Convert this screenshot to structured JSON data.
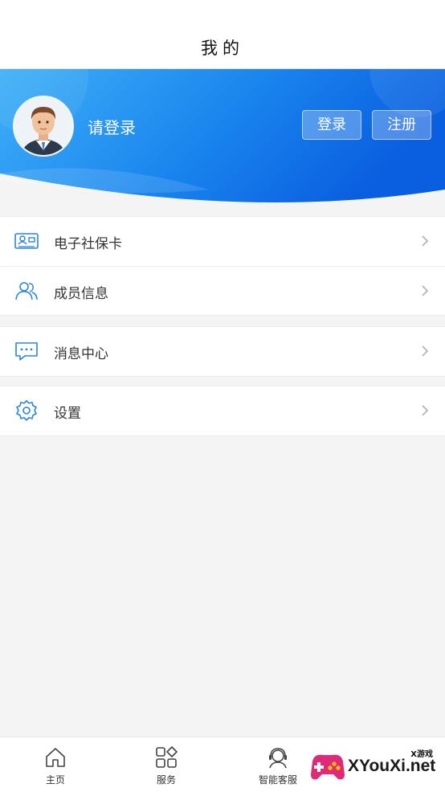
{
  "header": {
    "title": "我的"
  },
  "profile": {
    "login_prompt": "请登录",
    "login_label": "登录",
    "register_label": "注册"
  },
  "menu": {
    "group1": [
      {
        "label": "电子社保卡",
        "icon": "social-security-card-icon"
      },
      {
        "label": "成员信息",
        "icon": "members-icon"
      }
    ],
    "group2": [
      {
        "label": "消息中心",
        "icon": "message-icon"
      }
    ],
    "group3": [
      {
        "label": "设置",
        "icon": "gear-icon"
      }
    ]
  },
  "tabbar": {
    "items": [
      {
        "label": "主页",
        "icon": "home-icon"
      },
      {
        "label": "服务",
        "icon": "services-icon"
      },
      {
        "label": "智能客服",
        "icon": "customer-service-icon"
      }
    ]
  },
  "watermark": {
    "top_text": "X游戏",
    "main_text": "XYouXi.net"
  },
  "colors": {
    "accent": "#1a8ff0",
    "banner_dark": "#0a5fe0",
    "icon_blue": "#2b87d6"
  }
}
